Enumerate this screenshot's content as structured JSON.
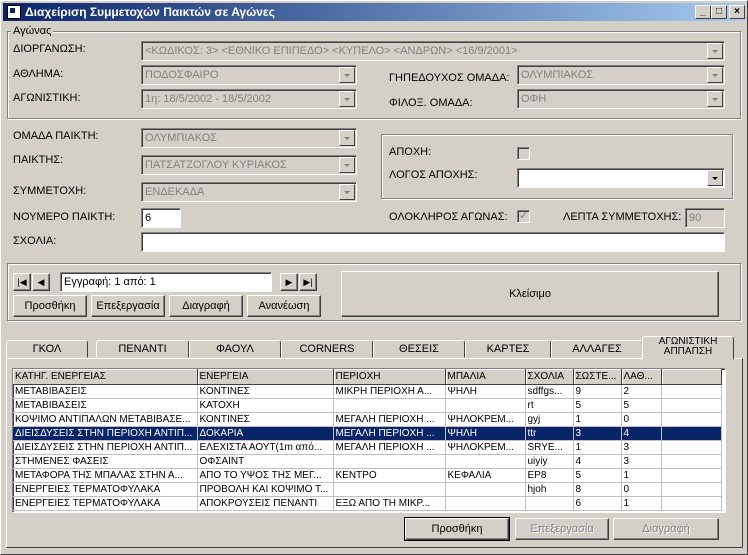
{
  "window": {
    "title": "Διαχείριση Συμμετοχών Παικτών σε Αγώνες"
  },
  "match_group": {
    "legend": "Αγώνας",
    "organization_label": "ΔΙΟΡΓΑΝΩΣΗ:",
    "organization_value": "<ΚΩΔΙΚΟΣ:  3> <ΕΘΝΙΚΟ ΕΠΙΠΕΔΟ> <ΚΥΠΕΛΟ> <ΑΝΔΡΩΝ> <16/9/2001>",
    "sport_label": "ΑΘΛΗΜΑ:",
    "sport_value": "ΠΟΔΟΣΦΑΙΡΟ",
    "season_label": "ΑΓΩΝΙΣΤΙΚΗ:",
    "season_value": "1η: 18/5/2002 - 18/5/2002",
    "home_team_label": "ΓΗΠΕΔΟΥΧΟΣ ΟΜΑΔΑ:",
    "home_team_value": "ΟΛΥΜΠΙΑΚΟΣ",
    "guest_team_label": "ΦΙΛΟΞ. ΟΜΑΔΑ:",
    "guest_team_value": "ΟΦΗ"
  },
  "player": {
    "team_label": "ΟΜΑΔΑ ΠΑΙΚΤΗ:",
    "team_value": "ΟΛΥΜΠΙΑΚΟΣ",
    "player_label": "ΠΑΙΚΤΗΣ:",
    "player_value": "ΠΑΤΣΑΤΖΟΓΛΟΥ ΚΥΡΙΑΚΟΣ",
    "participation_label": "ΣΥΜΜΕΤΟΧΗ:",
    "participation_value": "ΕΝΔΕΚΑΔΑ",
    "number_label": "ΝΟΥΜΕΡΟ ΠΑΙΚΤΗ:",
    "number_value": "6",
    "comments_label": "ΣΧΟΛΙΑ:",
    "comments_value": ""
  },
  "absence": {
    "absence_label": "ΑΠΟΧΗ:",
    "absence_checked": false,
    "reason_label": "ΛΟΓΟΣ ΑΠΟΧΗΣ:",
    "reason_value": ""
  },
  "full_match_label": "ΟΛΟΚΛΗΡΟΣ ΑΓΩΝΑΣ:",
  "full_match_checked": true,
  "minutes_label": "ΛΕΠΤΑ ΣΥΜΜΕΤΟΧΗΣ:",
  "minutes_value": "90",
  "navigator": {
    "record_text": "Εγγραφή: 1 από: 1",
    "add_label": "Προσθήκη",
    "edit_label": "Επεξεργασία",
    "delete_label": "Διαγραφή",
    "refresh_label": "Ανανέωση",
    "close_label": "Κλείσιμο"
  },
  "tabs": [
    "ΓΚΟΛ",
    "ΠΕΝΑΝΤΙ",
    "ΦΑΟΥΛ",
    "CORNERS",
    "ΘΕΣΕΙΣ",
    "ΚΑΡΤΕΣ",
    "ΑΛΛΑΓΕΣ",
    "ΑΓΩΝΙΣΤΙΚΗ ΑΠΠΑΠΣΗ"
  ],
  "grid": {
    "columns": [
      "ΚΑΤΗΓ. ΕΝΕΡΓΕΙΑΣ",
      "ΕΝΕΡΓΕΙΑ",
      "ΠΕΡΙΟΧΗ",
      "ΜΠΑΛΙΑ",
      "ΣΧΟΛΙΑ",
      "ΣΩΣΤΕ...",
      "ΛΑΘ..."
    ],
    "rows": [
      [
        "ΜΕΤΑΒΙΒΑΣΕΙΣ",
        "ΚΟΝΤΙΝΕΣ",
        "ΜΙΚΡΗ ΠΕΡΙΟΧΗ Α...",
        "ΨΗΛΗ",
        "sdffgs...",
        "9",
        "2"
      ],
      [
        "ΜΕΤΑΒΙΒΑΣΕΙΣ",
        "ΚΑΤΟΧΗ",
        "",
        "",
        "rt",
        "5",
        "5"
      ],
      [
        "ΚΟΨΙΜΟ ΑΝΤΙΠΑΛΩΝ ΜΕΤΑΒΙΒΑΣΕ...",
        "ΚΟΝΤΙΝΕΣ",
        "ΜΕΓΑΛΗ ΠΕΡΙΟΧΗ ...",
        "ΨΗΛΟΚΡΕΜ...",
        "gyj",
        "1",
        "0"
      ],
      [
        "ΔΙΕΙΣΔΥΣΕΙΣ ΣΤΗΝ ΠΕΡΙΟΧΗ ΑΝΤΙΠ...",
        "ΔΟΚΑΡΙΑ",
        "ΜΕΓΑΛΗ ΠΕΡΙΟΧΗ ...",
        "ΨΗΛΗ",
        "ttr",
        "3",
        "4"
      ],
      [
        "ΔΙΕΙΣΔΥΣΕΙΣ ΣΤΗΝ ΠΕΡΙΟΧΗ ΑΝΤΙΠ...",
        "ΕΛΕΧΙΣΤΑ ΑΟΥΤ(1m από...",
        "ΜΕΓΑΛΗ ΠΕΡΙΟΧΗ ...",
        "ΨΗΛΟΚΡΕΜ...",
        "SRYE...",
        "1",
        "3"
      ],
      [
        "ΣΤΗΜΕΝΕΣ ΦΑΣΕΙΣ",
        "ΟΦΣΑΙΝΤ",
        "",
        "",
        "uiyiy",
        "4",
        "3"
      ],
      [
        "ΜΕΤΑΦΟΡΑ ΤΗΣ ΜΠΑΛΑΣ ΣΤΗΝ Α...",
        "ΑΠΟ ΤΟ ΥΨΟΣ ΤΗΣ ΜΕΓ...",
        "ΚΕΝΤΡΟ",
        "ΚΕΦΑΛΙΑ",
        "EP8",
        "5",
        "1"
      ],
      [
        "ΕΝΕΡΓΕΙΕΣ ΤΕΡΜΑΤΟΦΥΛΑΚΑ",
        "ΠΡΟΒΟΛΗ ΚΑΙ ΚΟΨΙΜΟ Τ...",
        "",
        "",
        "hjoh",
        "8",
        "0"
      ],
      [
        "ΕΝΕΡΓΕΙΕΣ ΤΕΡΜΑΤΟΦΥΛΑΚΑ",
        "ΑΠΟΚΡΟΥΣΕΙΣ ΠΕΝΑΝΤΙ",
        "ΕΞΩ ΑΠΟ ΤΗ ΜΙΚΡ...",
        "",
        "",
        "6",
        "1"
      ]
    ],
    "selected_row": 3
  },
  "grid_buttons": {
    "add_label": "Προσθήκη",
    "edit_label": "Επεξεργασία",
    "delete_label": "Διαγραφή"
  }
}
